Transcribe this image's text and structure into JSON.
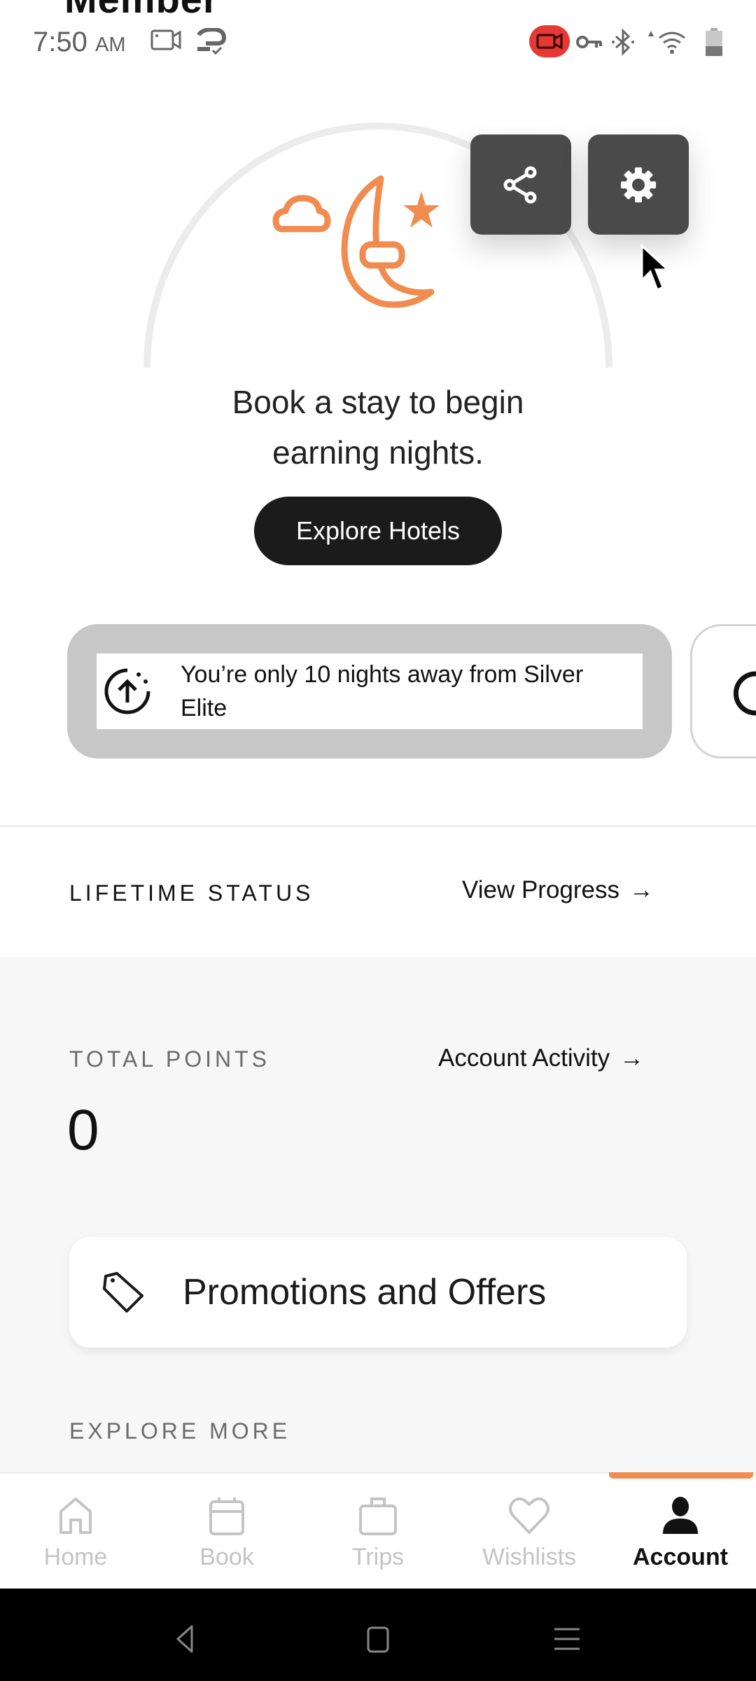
{
  "header": {
    "cut_title": "Member"
  },
  "status_bar": {
    "time": "7:50",
    "ampm": "AM",
    "icons": [
      "screen-record-icon",
      "sync-icon",
      "recording-active-icon",
      "vpn-key-icon",
      "bluetooth-icon",
      "wifi-icon",
      "battery-icon"
    ]
  },
  "colors": {
    "accent": "#f08c50",
    "dark_button": "#1b1b1b",
    "floating_button": "#4a4a4a",
    "record_badge": "#e53935"
  },
  "hero": {
    "illustration": "moon-cloud-star-icon",
    "message_line1": "Book a stay to begin",
    "message_line2": "earning nights.",
    "explore_button": "Explore Hotels"
  },
  "floating_actions": {
    "share": "share-icon",
    "settings": "gear-icon"
  },
  "milestones": [
    {
      "icon": "arrow-up-circle-icon",
      "text_line1": "You’re only 10 nights away from Silver",
      "text_line2": "Elite"
    },
    {
      "icon": "refresh-icon"
    }
  ],
  "lifetime_status": {
    "label": "LIFETIME STATUS",
    "link": "View Progress",
    "link_arrow": "→"
  },
  "points": {
    "label": "TOTAL POINTS",
    "value": "0",
    "link": "Account Activity",
    "link_arrow": "→"
  },
  "promotions": {
    "label": "Promotions and Offers",
    "icon": "tag-icon"
  },
  "explore_more": {
    "label": "EXPLORE MORE"
  },
  "bottom_nav": {
    "items": [
      {
        "label": "Home",
        "icon": "home-icon",
        "active": false
      },
      {
        "label": "Book",
        "icon": "calendar-icon",
        "active": false
      },
      {
        "label": "Trips",
        "icon": "briefcase-icon",
        "active": false
      },
      {
        "label": "Wishlists",
        "icon": "heart-icon",
        "active": false
      },
      {
        "label": "Account",
        "icon": "person-icon",
        "active": true
      }
    ]
  },
  "system_nav": [
    "back-icon",
    "home-square-icon",
    "recents-icon"
  ]
}
